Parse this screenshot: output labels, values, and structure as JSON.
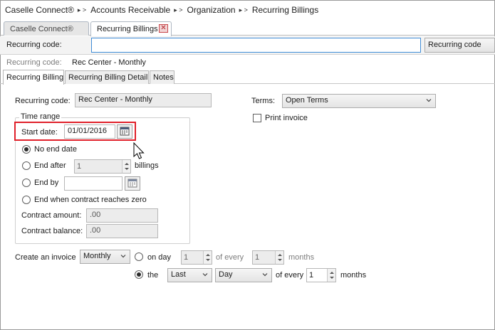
{
  "breadcrumb": [
    "Caselle Connect®",
    "Accounts Receivable",
    "Organization",
    "Recurring Billings"
  ],
  "breadcrumb_separator": "▸ >",
  "doc_tabs": {
    "home": "Caselle Connect®",
    "active": "Recurring Billings",
    "close_glyph": "✕"
  },
  "search": {
    "label": "Recurring code:",
    "value": "",
    "field_selector": "Recurring code"
  },
  "current_record": {
    "label": "Recurring code:",
    "value": "Rec Center - Monthly"
  },
  "subtabs": [
    "Recurring Billing",
    "Recurring Billing Detail",
    "Notes"
  ],
  "form": {
    "recurring_code_label": "Recurring code:",
    "recurring_code_value": "Rec Center - Monthly",
    "terms_label": "Terms:",
    "terms_value": "Open Terms",
    "print_invoice_label": "Print invoice",
    "print_invoice_checked": false,
    "time_range": {
      "legend": "Time range",
      "start_date_label": "Start date:",
      "start_date_value": "01/01/2016",
      "no_end_date_label": "No end date",
      "end_after_label": "End after",
      "end_after_value": "1",
      "billings_label": "billings",
      "end_by_label": "End by",
      "end_by_value": "",
      "end_contract_zero_label": "End when contract reaches zero",
      "selected_option": "No end date",
      "contract_amount_label": "Contract amount:",
      "contract_amount_value": ".00",
      "contract_balance_label": "Contract balance:",
      "contract_balance_value": ".00"
    },
    "create_invoice": {
      "label": "Create an invoice",
      "frequency_value": "Monthly",
      "on_day_label": "on day",
      "on_day_value": "1",
      "of_every_label_1": "of every",
      "months_value_1": "1",
      "months_label_1": "months",
      "the_label": "the",
      "ordinal_value": "Last",
      "day_value": "Day",
      "of_every_label_2": "of every",
      "months_value_2": "1",
      "months_label_2": "months",
      "selected_option": "the"
    }
  },
  "colors": {
    "highlight": "#e0202a",
    "focus_border": "#3f8cd6",
    "tab_close": "#c8474b"
  }
}
